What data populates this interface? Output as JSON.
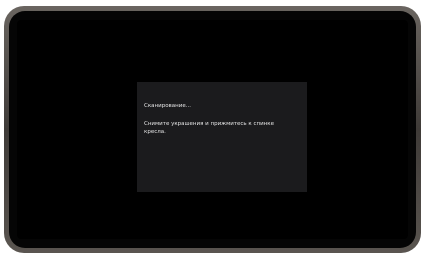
{
  "dialog": {
    "status": "Сканирование...",
    "instruction": "Снимите украшения и прижмитесь к спинке кресла."
  }
}
